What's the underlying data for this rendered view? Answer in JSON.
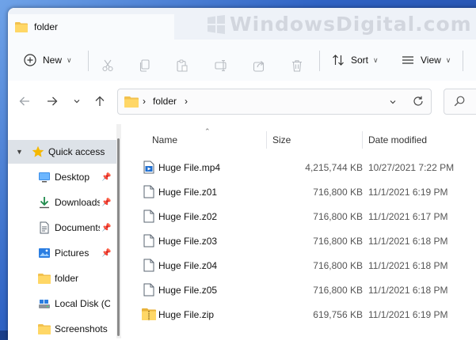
{
  "window": {
    "tab_title": "folder"
  },
  "watermark": "WindowsDigital.com",
  "toolbar": {
    "new_label": "New",
    "sort_label": "Sort",
    "view_label": "View"
  },
  "address": {
    "crumb": "folder"
  },
  "sidebar": {
    "items": [
      {
        "label": "Quick access",
        "icon": "star-icon"
      },
      {
        "label": "Desktop",
        "icon": "desktop-icon",
        "pinned": true
      },
      {
        "label": "Downloads",
        "icon": "download-icon",
        "pinned": true
      },
      {
        "label": "Documents",
        "icon": "document-icon",
        "pinned": true
      },
      {
        "label": "Pictures",
        "icon": "pictures-icon",
        "pinned": true
      },
      {
        "label": "folder",
        "icon": "folder-icon"
      },
      {
        "label": "Local Disk (C:)",
        "icon": "drive-icon"
      },
      {
        "label": "Screenshots",
        "icon": "folder-icon"
      }
    ]
  },
  "columns": {
    "name": "Name",
    "size": "Size",
    "date": "Date modified"
  },
  "files": [
    {
      "name": "Huge File.mp4",
      "size": "4,215,744 KB",
      "date": "10/27/2021 7:22 PM",
      "icon": "video-file-icon"
    },
    {
      "name": "Huge File.z01",
      "size": "716,800 KB",
      "date": "11/1/2021 6:19 PM",
      "icon": "file-icon"
    },
    {
      "name": "Huge File.z02",
      "size": "716,800 KB",
      "date": "11/1/2021 6:17 PM",
      "icon": "file-icon"
    },
    {
      "name": "Huge File.z03",
      "size": "716,800 KB",
      "date": "11/1/2021 6:18 PM",
      "icon": "file-icon"
    },
    {
      "name": "Huge File.z04",
      "size": "716,800 KB",
      "date": "11/1/2021 6:18 PM",
      "icon": "file-icon"
    },
    {
      "name": "Huge File.z05",
      "size": "716,800 KB",
      "date": "11/1/2021 6:18 PM",
      "icon": "file-icon"
    },
    {
      "name": "Huge File.zip",
      "size": "619,756 KB",
      "date": "11/1/2021 6:19 PM",
      "icon": "zip-folder-icon"
    }
  ]
}
